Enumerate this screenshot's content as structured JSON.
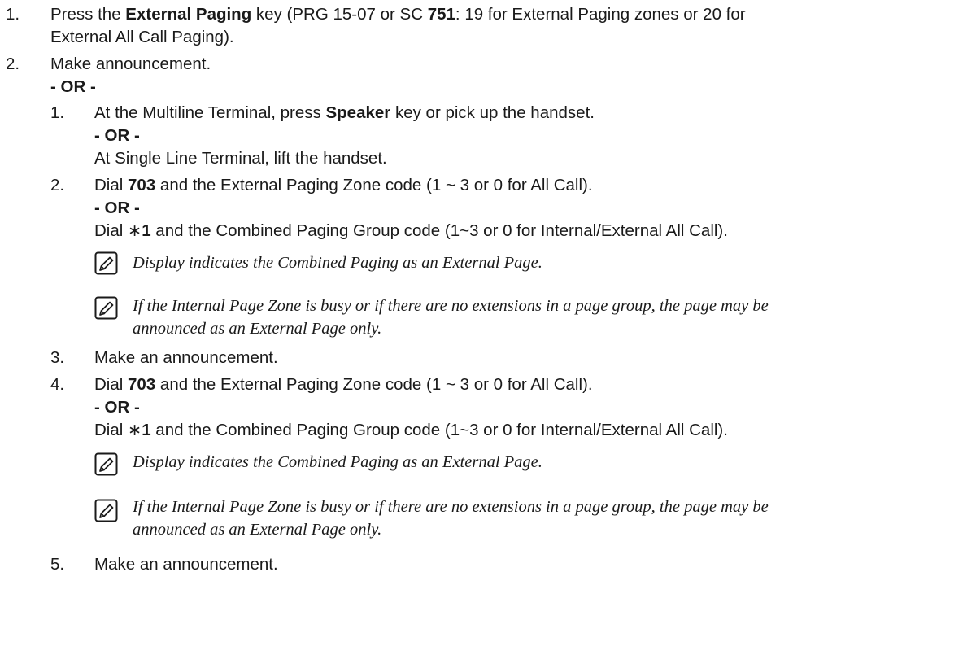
{
  "steps": [
    {
      "num": "1.",
      "lines": [
        {
          "a": "Press the ",
          "b": "External Paging",
          "c": " key (PRG 15-07 or SC ",
          "d": "751",
          "e": ": 19 for External Paging zones or 20 for"
        },
        "External All Call Paging)."
      ]
    },
    {
      "num": "2.",
      "text": "Make announcement.",
      "or": "- OR -",
      "substeps": [
        {
          "num": "1.",
          "pre": "At the Multiline Terminal, press ",
          "bold": "Speaker",
          "post": " key or pick up the handset.",
          "or": "- OR -",
          "alt": "At Single Line Terminal, lift the handset."
        },
        {
          "num": "2.",
          "pre": "Dial ",
          "bold": "703",
          "post": " and the External Paging Zone code (1 ~ 3 or 0 for All Call).",
          "or": "- OR -",
          "alt_pre": "Dial ∗",
          "alt_bold": "1",
          "alt_post": " and the Combined Paging Group code (1~3 or 0 for Internal/External All Call).",
          "note1": "Display indicates the Combined Paging as an External Page.",
          "note2_line1": "If the Internal Page Zone is busy or if there are no extensions in a page group, the page may be",
          "note2_line2": "announced as an External Page only."
        },
        {
          "num": "3.",
          "text": "Make an announcement."
        },
        {
          "num": "4.",
          "pre": "Dial ",
          "bold": "703",
          "post": " and the External Paging Zone code (1 ~ 3 or 0 for All Call).",
          "or": "- OR -",
          "alt_pre": "Dial ∗",
          "alt_bold": "1",
          "alt_post": " and the Combined Paging Group code (1~3 or 0 for Internal/External All Call).",
          "note1": "Display indicates the Combined Paging as an External Page.",
          "note2_line1": "If the Internal Page Zone is busy or if there are no extensions in a page group, the page may be",
          "note2_line2": "announced as an External Page only."
        },
        {
          "num": "5.",
          "text": "Make an announcement."
        }
      ]
    }
  ],
  "icons": {
    "note": "pencil-note-icon"
  }
}
